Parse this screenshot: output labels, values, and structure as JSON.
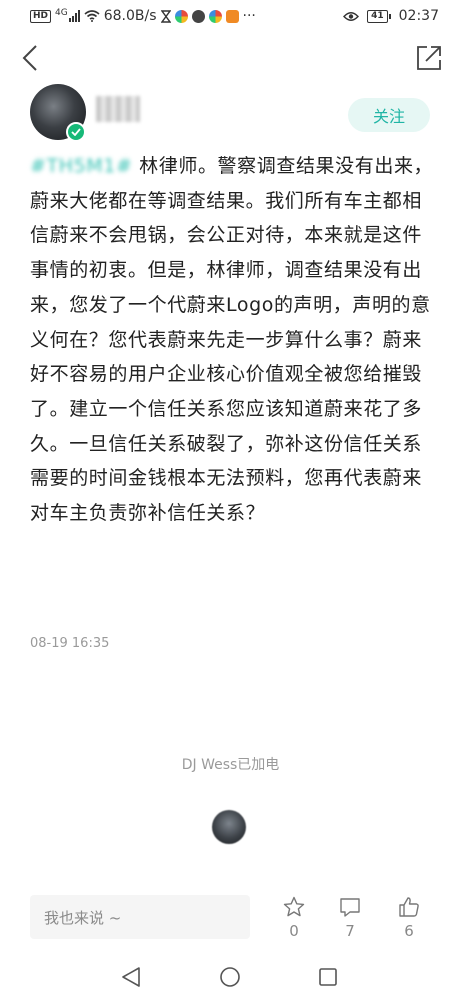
{
  "status_bar": {
    "hd_badge": "HD",
    "network_type": "4G",
    "speed": "68.0B/s",
    "battery": "41",
    "time": "02:37"
  },
  "nav": {
    "back_icon": "chevron-left-icon",
    "share_icon": "share-icon"
  },
  "author": {
    "follow_label": "关注",
    "verified_color": "#17b978"
  },
  "post": {
    "hashtag": "#TH5M1#",
    "text": "林律师。警察调查结果没有出来，蔚来大佬都在等调查结果。我们所有车主都相信蔚来不会甩锅，会公正对待，本来就是这件事情的初衷。但是，林律师，调查结果没有出来，您发了一个代蔚来Logo的声明，声明的意义何在？您代表蔚来先走一步算什么事？蔚来好不容易的用户企业核心价值观全被您给摧毁了。建立一个信任关系您应该知道蔚来花了多久。一旦信任关系破裂了，弥补这份信任关系需要的时间金钱根本无法预料，您再代表蔚来对车主负责弥补信任关系？",
    "timestamp": "08-19 16:35",
    "hashtag_color": "#36c2b4"
  },
  "charge": {
    "text": "DJ Wess已加电"
  },
  "bottom_bar": {
    "comment_placeholder": "我也来说 ~",
    "star_count": "0",
    "comment_count": "7",
    "like_count": "6"
  },
  "accent_color": "#1fb5a5"
}
